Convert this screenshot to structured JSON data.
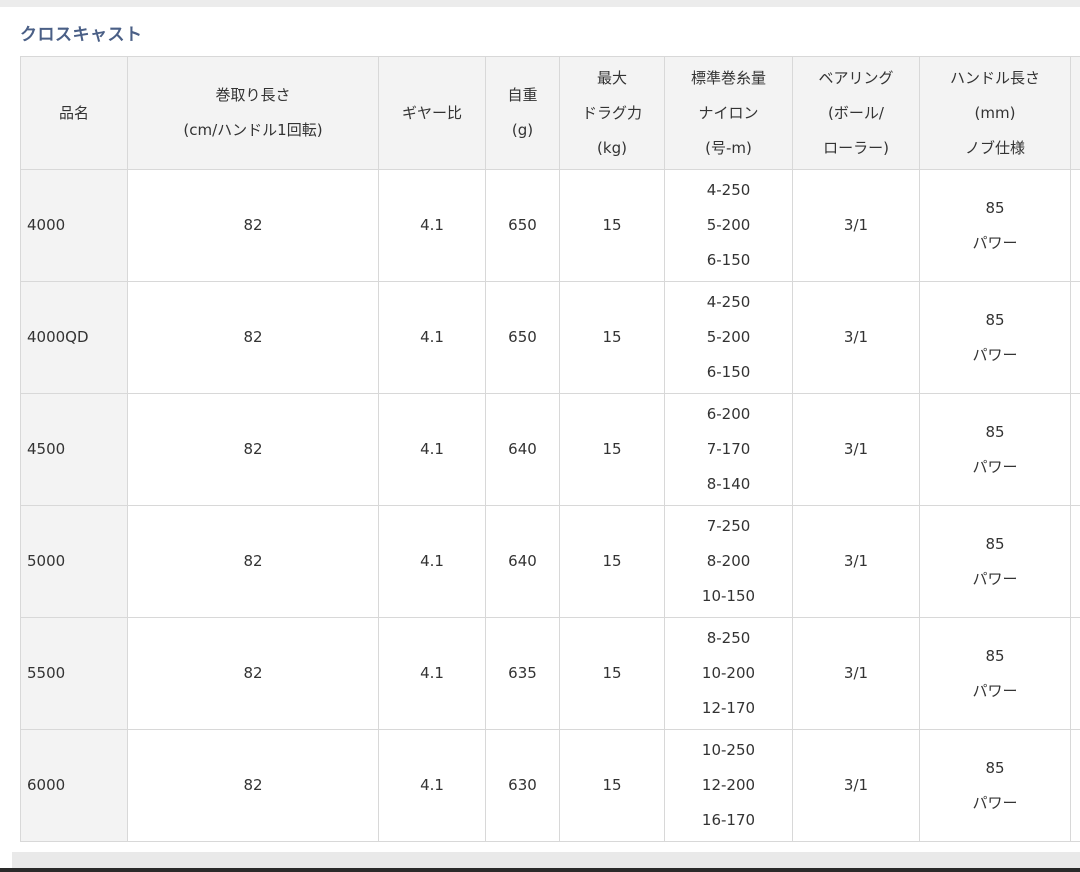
{
  "title": "クロスキャスト",
  "headers": [
    [
      "品名"
    ],
    [
      "巻取り長さ",
      "(cm/ハンドル1回転)"
    ],
    [
      "ギヤー比"
    ],
    [
      "自重",
      "(g)"
    ],
    [
      "最大",
      "ドラグ力",
      "(kg)"
    ],
    [
      "標準巻糸量",
      "ナイロン",
      "(号-m)"
    ],
    [
      "ベアリング",
      "(ボール/",
      "ローラー)"
    ],
    [
      "ハンドル長さ",
      "(mm)",
      "ノブ仕様"
    ]
  ],
  "rows": [
    {
      "name": "4000",
      "retrieve": "82",
      "gear": "4.1",
      "weight": "650",
      "drag": "15",
      "line": [
        "4-250",
        "5-200",
        "6-150"
      ],
      "bearing": "3/1",
      "handle": [
        "85",
        "パワー"
      ]
    },
    {
      "name": "4000QD",
      "retrieve": "82",
      "gear": "4.1",
      "weight": "650",
      "drag": "15",
      "line": [
        "4-250",
        "5-200",
        "6-150"
      ],
      "bearing": "3/1",
      "handle": [
        "85",
        "パワー"
      ]
    },
    {
      "name": "4500",
      "retrieve": "82",
      "gear": "4.1",
      "weight": "640",
      "drag": "15",
      "line": [
        "6-200",
        "7-170",
        "8-140"
      ],
      "bearing": "3/1",
      "handle": [
        "85",
        "パワー"
      ]
    },
    {
      "name": "5000",
      "retrieve": "82",
      "gear": "4.1",
      "weight": "640",
      "drag": "15",
      "line": [
        "7-250",
        "8-200",
        "10-150"
      ],
      "bearing": "3/1",
      "handle": [
        "85",
        "パワー"
      ]
    },
    {
      "name": "5500",
      "retrieve": "82",
      "gear": "4.1",
      "weight": "635",
      "drag": "15",
      "line": [
        "8-250",
        "10-200",
        "12-170"
      ],
      "bearing": "3/1",
      "handle": [
        "85",
        "パワー"
      ]
    },
    {
      "name": "6000",
      "retrieve": "82",
      "gear": "4.1",
      "weight": "630",
      "drag": "15",
      "line": [
        "10-250",
        "12-200",
        "16-170"
      ],
      "bearing": "3/1",
      "handle": [
        "85",
        "パワー"
      ]
    }
  ]
}
